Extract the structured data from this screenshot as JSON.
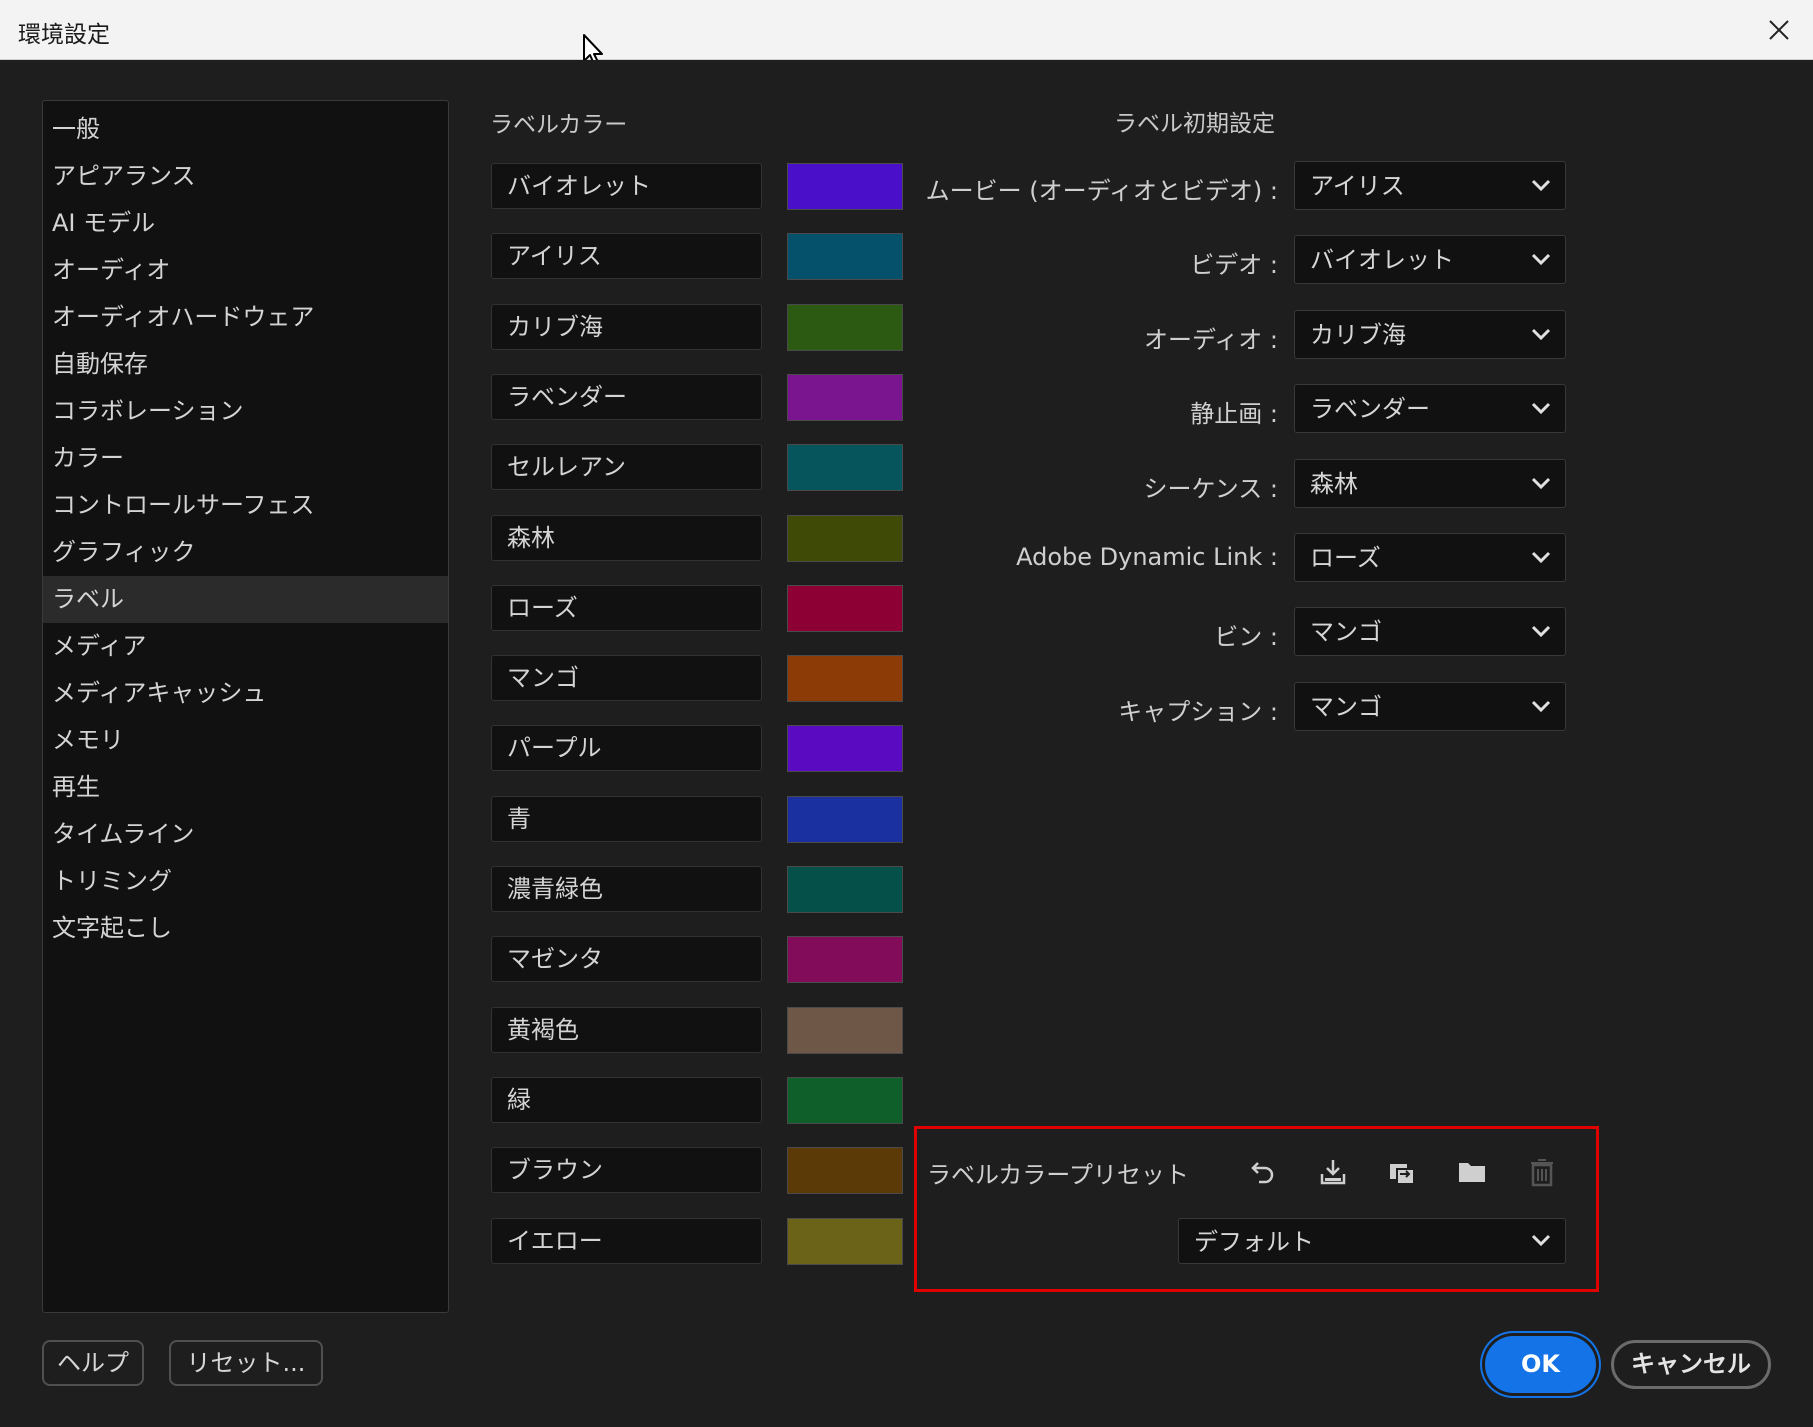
{
  "window": {
    "title": "環境設定"
  },
  "sidebar": {
    "items": [
      {
        "label": "一般"
      },
      {
        "label": "アピアランス"
      },
      {
        "label": "AI モデル"
      },
      {
        "label": "オーディオ"
      },
      {
        "label": "オーディオハードウェア"
      },
      {
        "label": "自動保存"
      },
      {
        "label": "コラボレーション"
      },
      {
        "label": "カラー"
      },
      {
        "label": "コントロールサーフェス"
      },
      {
        "label": "グラフィック"
      },
      {
        "label": "ラベル",
        "active": true
      },
      {
        "label": "メディア"
      },
      {
        "label": "メディアキャッシュ"
      },
      {
        "label": "メモリ"
      },
      {
        "label": "再生"
      },
      {
        "label": "タイムライン"
      },
      {
        "label": "トリミング"
      },
      {
        "label": "文字起こし"
      }
    ]
  },
  "label_colors": {
    "title": "ラベルカラー",
    "items": [
      {
        "name": "バイオレット",
        "color": "#4a0fc8"
      },
      {
        "name": "アイリス",
        "color": "#05506b"
      },
      {
        "name": "カリブ海",
        "color": "#2c5a12"
      },
      {
        "name": "ラベンダー",
        "color": "#7b158f"
      },
      {
        "name": "セルレアン",
        "color": "#07555c"
      },
      {
        "name": "森林",
        "color": "#3e4a05"
      },
      {
        "name": "ローズ",
        "color": "#8c0033"
      },
      {
        "name": "マンゴ",
        "color": "#8c3a06"
      },
      {
        "name": "パープル",
        "color": "#5a0ac0"
      },
      {
        "name": "青",
        "color": "#1a2fa0"
      },
      {
        "name": "濃青緑色",
        "color": "#06504a"
      },
      {
        "name": "マゼンタ",
        "color": "#820c5a"
      },
      {
        "name": "黄褐色",
        "color": "#6e5746"
      },
      {
        "name": "緑",
        "color": "#0f5f2a"
      },
      {
        "name": "ブラウン",
        "color": "#5c3a08"
      },
      {
        "name": "イエロー",
        "color": "#6b6418"
      }
    ]
  },
  "label_defaults": {
    "title": "ラベル初期設定",
    "items": [
      {
        "label": "ムービー (オーディオとビデオ) :",
        "value": "アイリス"
      },
      {
        "label": "ビデオ :",
        "value": "バイオレット"
      },
      {
        "label": "オーディオ :",
        "value": "カリブ海"
      },
      {
        "label": "静止画 :",
        "value": "ラベンダー"
      },
      {
        "label": "シーケンス :",
        "value": "森林"
      },
      {
        "label": "Adobe Dynamic Link :",
        "value": "ローズ"
      },
      {
        "label": "ビン :",
        "value": "マンゴ"
      },
      {
        "label": "キャプション :",
        "value": "マンゴ"
      }
    ]
  },
  "preset": {
    "label": "ラベルカラープリセット",
    "value": "デフォルト",
    "icons": [
      "undo-icon",
      "import-icon",
      "export-icon",
      "folder-icon",
      "trash-icon"
    ]
  },
  "buttons": {
    "help": "ヘルプ",
    "reset": "リセット...",
    "ok": "OK",
    "cancel": "キャンセル"
  },
  "colors": {
    "accent": "#1473e6",
    "highlight_box": "#e00000"
  }
}
